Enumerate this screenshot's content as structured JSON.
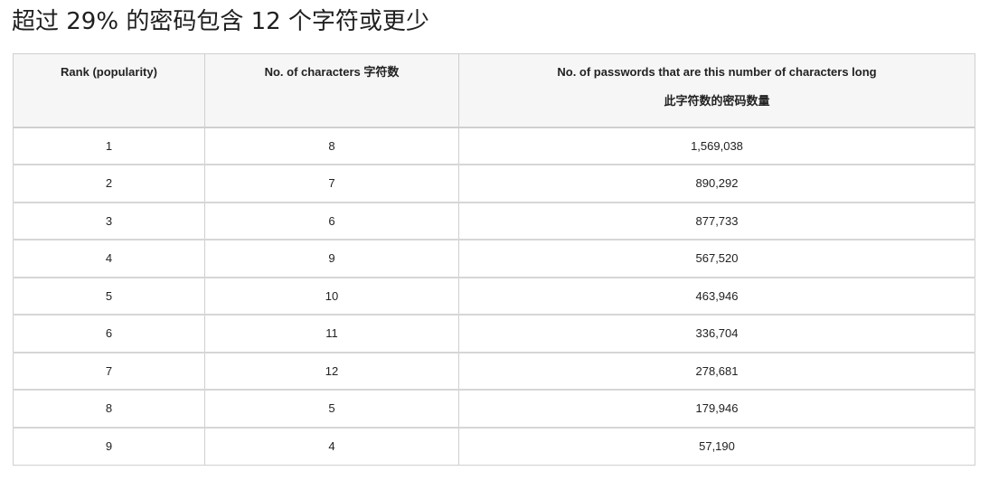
{
  "page": {
    "title": "超过 29% 的密码包含 12 个字符或更少"
  },
  "table": {
    "headers": {
      "rank": "Rank (popularity)",
      "characters": "No. of characters 字符数",
      "passwords_line1": "No. of passwords that are this number of characters long",
      "passwords_line2": "此字符数的密码数量"
    },
    "rows": [
      {
        "rank": "1",
        "characters": "8",
        "passwords": "1,569,038"
      },
      {
        "rank": "2",
        "characters": "7",
        "passwords": "890,292"
      },
      {
        "rank": "3",
        "characters": "6",
        "passwords": "877,733"
      },
      {
        "rank": "4",
        "characters": "9",
        "passwords": "567,520"
      },
      {
        "rank": "5",
        "characters": "10",
        "passwords": "463,946"
      },
      {
        "rank": "6",
        "characters": "11",
        "passwords": "336,704"
      },
      {
        "rank": "7",
        "characters": "12",
        "passwords": "278,681"
      },
      {
        "rank": "8",
        "characters": "5",
        "passwords": "179,946"
      },
      {
        "rank": "9",
        "characters": "4",
        "passwords": "57,190"
      }
    ]
  }
}
